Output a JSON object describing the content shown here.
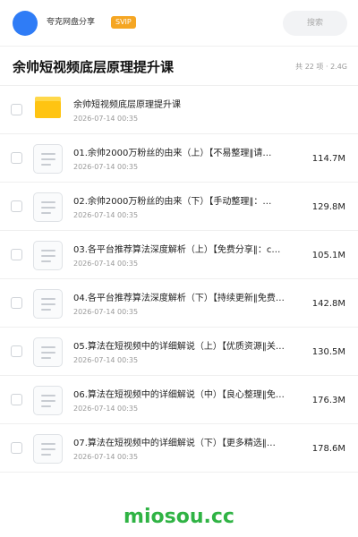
{
  "header": {
    "user_name": "夸克网盘分享",
    "vip_label": "SVIP",
    "search_placeholder": "搜索"
  },
  "folder": {
    "title": "余帅短视频底层原理提升课",
    "meta": "共 22 项 · 2.4G"
  },
  "items": [
    {
      "type": "folder",
      "name": "余帅短视频底层原理提升课",
      "date": "2026-07-14 00:35",
      "size": ""
    },
    {
      "type": "file",
      "name": "01.余帅2000万粉丝的由来（上）【不易整理‖请…",
      "date": "2026-07-14 00:35",
      "size": "114.7M"
    },
    {
      "type": "file",
      "name": "02.余帅2000万粉丝的由来（下）【手动整理‖：…",
      "date": "2026-07-14 00:35",
      "size": "129.8M"
    },
    {
      "type": "file",
      "name": "03.各平台推荐算法深度解析（上）【免费分享‖：c…",
      "date": "2026-07-14 00:35",
      "size": "105.1M"
    },
    {
      "type": "file",
      "name": "04.各平台推荐算法深度解析（下）【持续更新‖免费…",
      "date": "2026-07-14 00:35",
      "size": "142.8M"
    },
    {
      "type": "file",
      "name": "05.算法在短视频中的详细解说（上）【优质资源‖关…",
      "date": "2026-07-14 00:35",
      "size": "130.5M"
    },
    {
      "type": "file",
      "name": "06.算法在短视频中的详细解说（中）【良心整理‖免…",
      "date": "2026-07-14 00:35",
      "size": "176.3M"
    },
    {
      "type": "file",
      "name": "07.算法在短视频中的详细解说（下）【更多精选‖…",
      "date": "2026-07-14 00:35",
      "size": "178.6M"
    }
  ],
  "watermark": "miosou.cc",
  "colors": {
    "avatar": "#2f7cf6",
    "vip_badge": "#f5a623",
    "folder": "#ffc412",
    "watermark": "#2fb344"
  }
}
